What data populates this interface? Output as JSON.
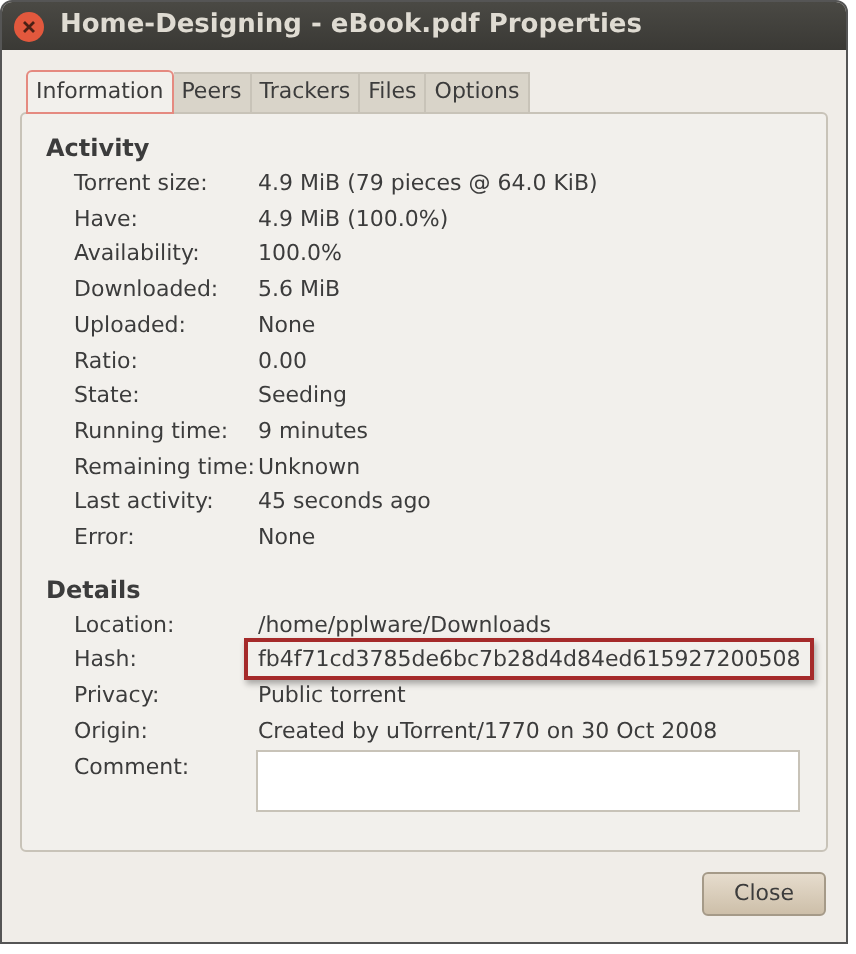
{
  "window": {
    "title": "Home-Designing - eBook.pdf Properties"
  },
  "tabs": [
    {
      "label": "Information",
      "selected": true
    },
    {
      "label": "Peers",
      "selected": false
    },
    {
      "label": "Trackers",
      "selected": false
    },
    {
      "label": "Files",
      "selected": false
    },
    {
      "label": "Options",
      "selected": false
    }
  ],
  "sections": [
    {
      "title": "Activity",
      "rows": [
        {
          "label": "Torrent size:",
          "value": "4.9 MiB (79 pieces @ 64.0 KiB)"
        },
        {
          "label": "Have:",
          "value": "4.9 MiB (100.0%)"
        },
        {
          "label": "Availability:",
          "value": "100.0%"
        },
        {
          "label": "Downloaded:",
          "value": "5.6 MiB"
        },
        {
          "label": "Uploaded:",
          "value": "None"
        },
        {
          "label": "Ratio:",
          "value": "0.00"
        },
        {
          "label": "State:",
          "value": "Seeding"
        },
        {
          "label": "Running time:",
          "value": "9 minutes"
        },
        {
          "label": "Remaining time:",
          "value": "Unknown"
        },
        {
          "label": "Last activity:",
          "value": "45 seconds ago"
        },
        {
          "label": "Error:",
          "value": "None"
        }
      ]
    },
    {
      "title": "Details",
      "rows": [
        {
          "label": "Location:",
          "value": "/home/pplware/Downloads"
        },
        {
          "label": "Hash:",
          "value": "fb4f71cd3785de6bc7b28d4d84ed615927200508",
          "highlighted": true
        },
        {
          "label": "Privacy:",
          "value": "Public torrent"
        },
        {
          "label": "Origin:",
          "value": "Created by uTorrent/1770 on 30 Oct 2008"
        },
        {
          "label": "Comment:",
          "kind": "field"
        }
      ]
    }
  ],
  "buttons": [
    "Close"
  ]
}
